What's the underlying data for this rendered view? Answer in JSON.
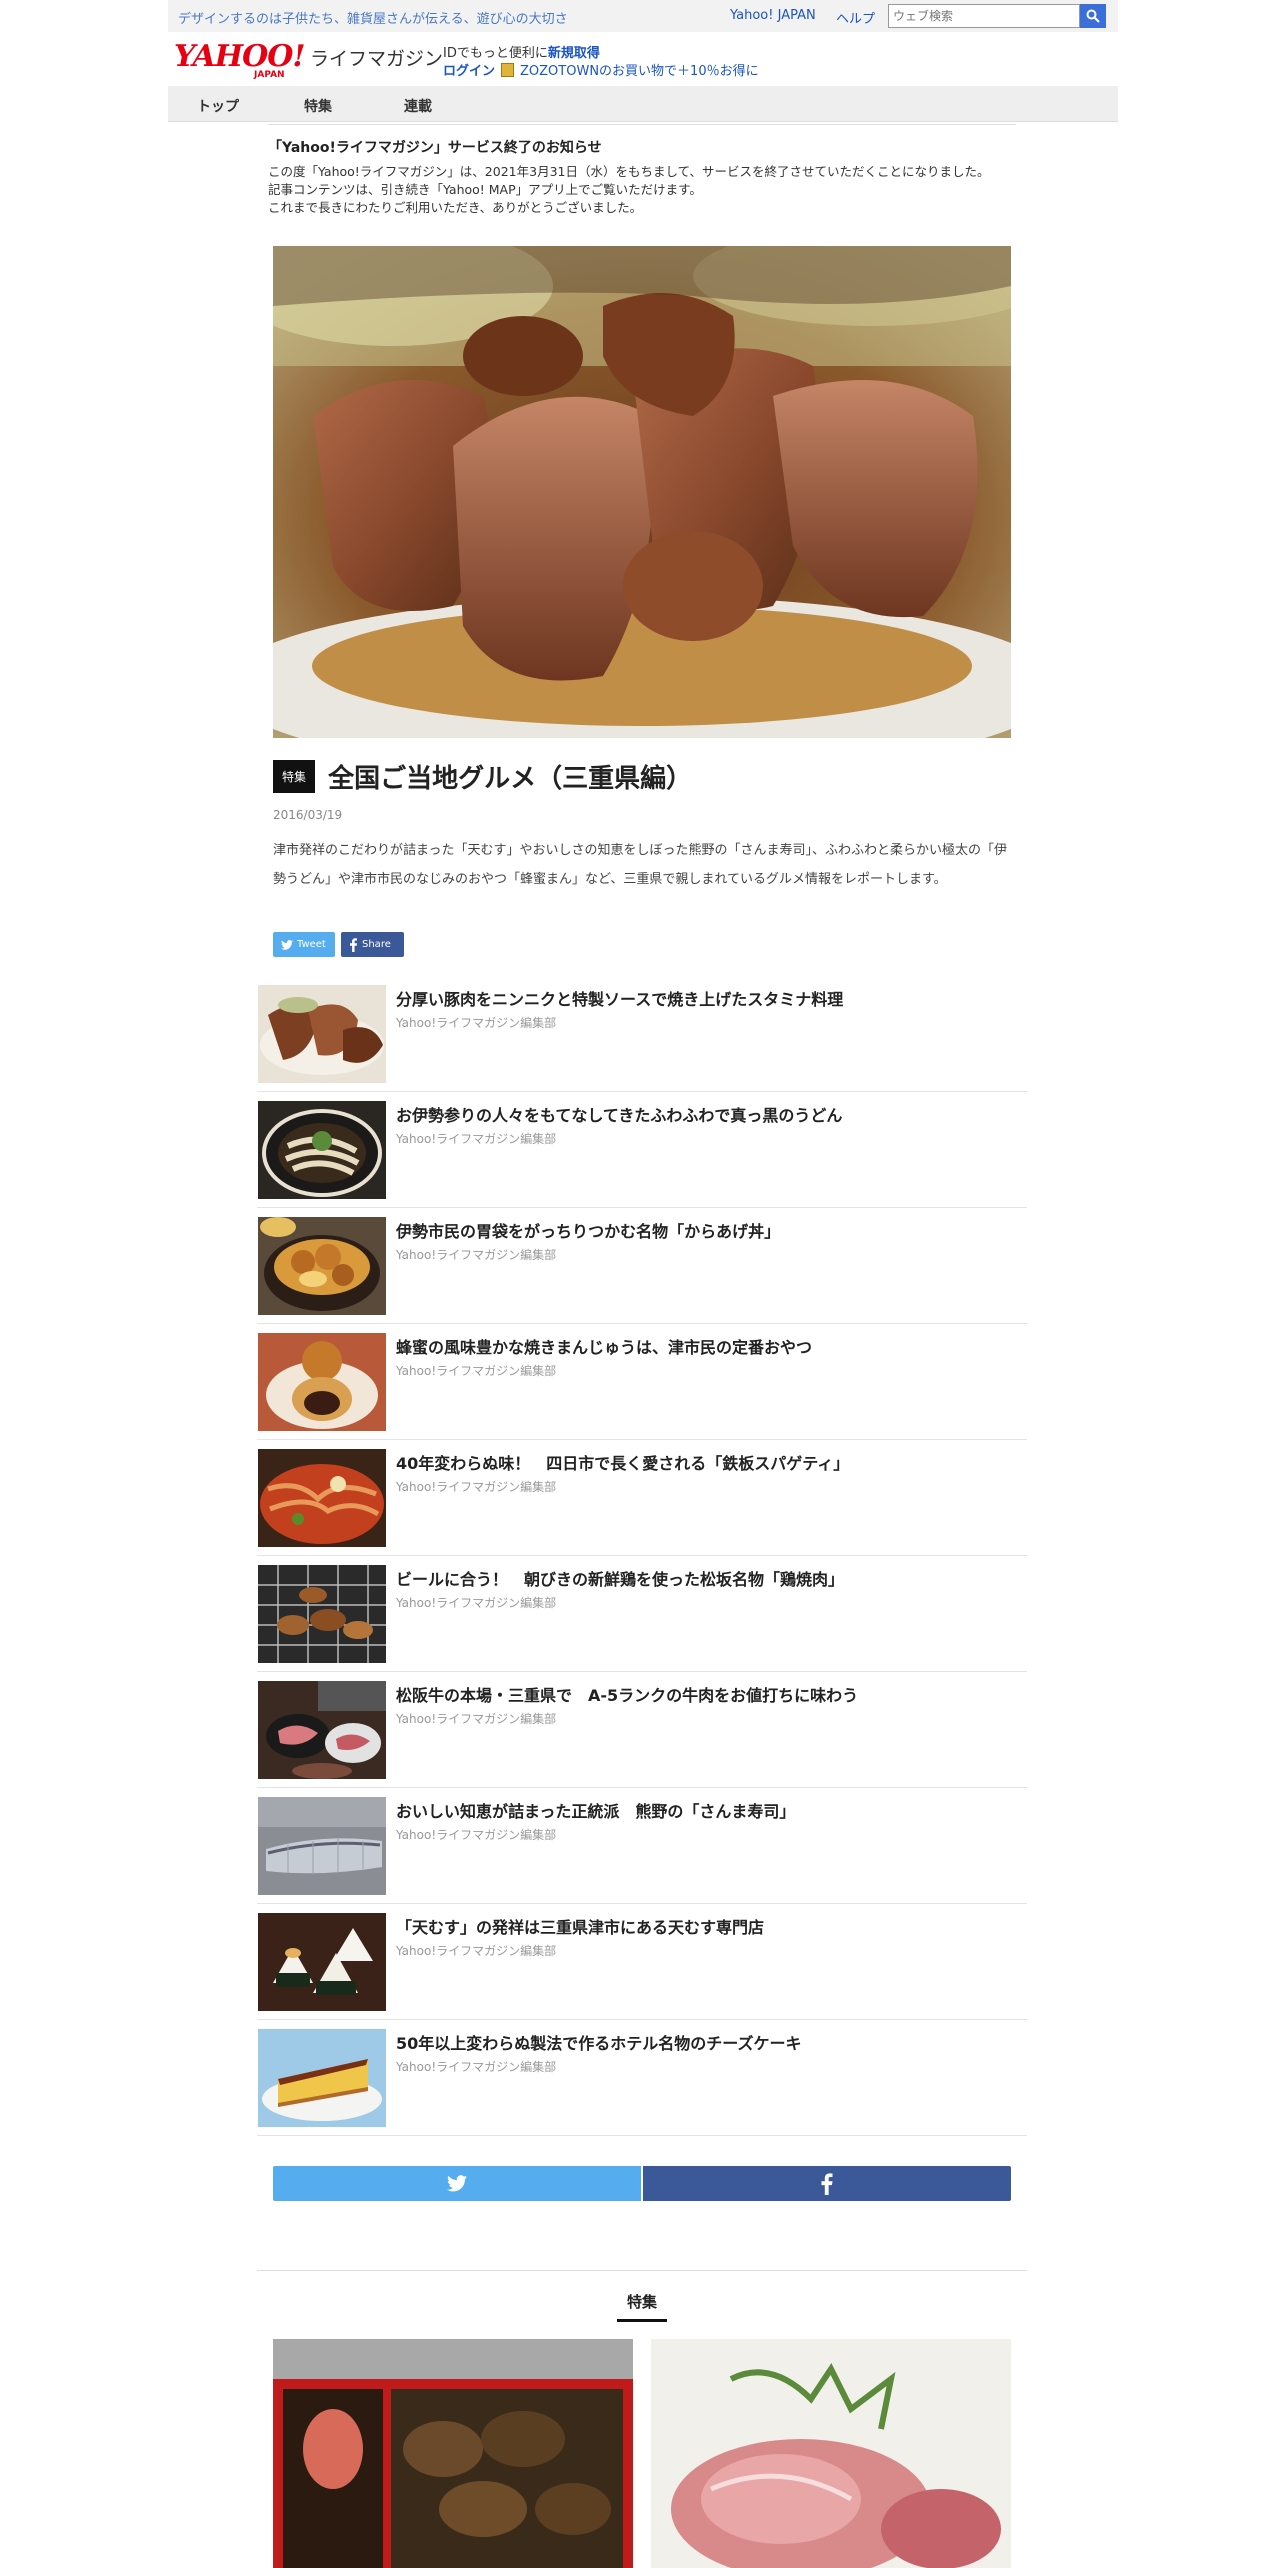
{
  "topbar": {
    "tagline": "デザインするのは子供たち、雑貨屋さんが伝える、遊び心の大切さ",
    "yahoo_japan_link": "Yahoo! JAPAN",
    "help_link": "ヘルプ",
    "search_placeholder": "ウェブ検索"
  },
  "header": {
    "logo_text": "YAHOO!",
    "logo_sub": "JAPAN",
    "site_name": "ライフマガジン",
    "id_prompt": "IDでもっと便利に",
    "register_link": "新規取得",
    "login_link": "ログイン",
    "zozo_promo": "ZOZOTOWNのお買い物で＋10％お得に"
  },
  "nav": {
    "items": [
      "トップ",
      "特集",
      "連載"
    ]
  },
  "notice": {
    "title": "「Yahoo!ライフマガジン」サービス終了のお知らせ",
    "line1": "この度「Yahoo!ライフマガジン」は、2021年3月31日（水）をもちまして、サービスを終了させていただくことになりました。",
    "line2": "記事コンテンツは、引き続き「Yahoo! MAP」アプリ上でご覧いただけます。",
    "line3": "これまで長きにわたりご利用いただき、ありがとうございました。"
  },
  "article": {
    "badge": "特集",
    "title": "全国ご当地グルメ（三重県編）",
    "date": "2016/03/19",
    "lead": "津市発祥のこだわりが詰まった「天むす」やおいしさの知恵をしぼった熊野の「さんま寿司」、ふわふわと柔らかい極太の「伊勢うどん」や津市市民のなじみのおやつ「蜂蜜まん」など、三重県で親しまれているグルメ情報をレポートします。",
    "tweet_label": "Tweet",
    "share_label": "Share"
  },
  "list": [
    {
      "title": "分厚い豚肉をニンニクと特製ソースで焼き上げたスタミナ料理",
      "author": "Yahoo!ライフマガジン編集部"
    },
    {
      "title": "お伊勢参りの人々をもてなしてきたふわふわで真っ黒のうどん",
      "author": "Yahoo!ライフマガジン編集部"
    },
    {
      "title": "伊勢市民の胃袋をがっちりつかむ名物「からあげ丼」",
      "author": "Yahoo!ライフマガジン編集部"
    },
    {
      "title": "蜂蜜の風味豊かな焼きまんじゅうは、津市民の定番おやつ",
      "author": "Yahoo!ライフマガジン編集部"
    },
    {
      "title": "40年変わらぬ味！　四日市で長く愛される「鉄板スパゲティ」",
      "author": "Yahoo!ライフマガジン編集部"
    },
    {
      "title": "ビールに合う！　朝びきの新鮮鶏を使った松坂名物「鶏焼肉」",
      "author": "Yahoo!ライフマガジン編集部"
    },
    {
      "title": "松阪牛の本場・三重県で　A-5ランクの牛肉をお値打ちに味わう",
      "author": "Yahoo!ライフマガジン編集部"
    },
    {
      "title": "おいしい知恵が詰まった正統派　熊野の「さんま寿司」",
      "author": "Yahoo!ライフマガジン編集部"
    },
    {
      "title": "「天むす」の発祥は三重県津市にある天むす専門店",
      "author": "Yahoo!ライフマガジン編集部"
    },
    {
      "title": "50年以上変わらぬ製法で作るホテル名物のチーズケーキ",
      "author": "Yahoo!ライフマガジン編集部"
    }
  ],
  "features": {
    "heading": "特集"
  },
  "colors": {
    "yahoo_red": "#e60012",
    "link_blue": "#1a55c4",
    "twitter": "#55acee",
    "facebook": "#3b5998"
  }
}
